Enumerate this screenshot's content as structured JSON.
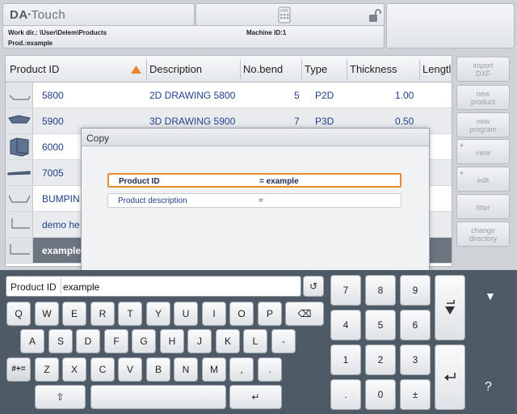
{
  "header": {
    "logo_main": "DA",
    "logo_sub": "Touch",
    "work_dir": "Work dir.: \\User\\Delem\\Products",
    "machine_id": "Machine ID:1",
    "product": "Prod.:example"
  },
  "table": {
    "columns": [
      "Product ID",
      "Description",
      "No.bend",
      "Type",
      "Thickness",
      "Lengtl"
    ],
    "rows": [
      {
        "id": "5800",
        "desc": "2D DRAWING 5800",
        "bends": "5",
        "type": "P2D",
        "thickness": "1.00"
      },
      {
        "id": "5900",
        "desc": "3D DRAWING 5900",
        "bends": "7",
        "type": "P3D",
        "thickness": "0.50"
      },
      {
        "id": "6000"
      },
      {
        "id": "7005"
      },
      {
        "id": "BUMPIN"
      },
      {
        "id": "demo he"
      },
      {
        "id": "example"
      }
    ]
  },
  "side_buttons": [
    {
      "label1": "import",
      "label2": "DXF"
    },
    {
      "label1": "new",
      "label2": "product"
    },
    {
      "label1": "new",
      "label2": "program"
    },
    {
      "label1": "view",
      "label2": "",
      "plus": "+"
    },
    {
      "label1": "edit",
      "label2": "",
      "plus": "+"
    },
    {
      "label1": "filter",
      "label2": ""
    },
    {
      "label1": "change",
      "label2": "directory"
    }
  ],
  "dialog": {
    "title": "Copy",
    "field1_label": "Product ID",
    "field1_eq": "= example",
    "field2_label": "Product description",
    "field2_eq": "="
  },
  "keyboard": {
    "input_label": "Product ID",
    "input_value": "example",
    "row1": [
      "Q",
      "W",
      "E",
      "R",
      "T",
      "Y",
      "U",
      "I",
      "O",
      "P"
    ],
    "row2": [
      "A",
      "S",
      "D",
      "F",
      "G",
      "H",
      "J",
      "K",
      "L",
      "-"
    ],
    "row3": [
      "Z",
      "X",
      "C",
      "V",
      "B",
      "N",
      "M",
      ",",
      "."
    ],
    "special": "#+=",
    "numpad": [
      "7",
      "8",
      "9",
      "4",
      "5",
      "6",
      "1",
      "2",
      "3",
      ".",
      "0",
      "±"
    ],
    "help": "?"
  }
}
